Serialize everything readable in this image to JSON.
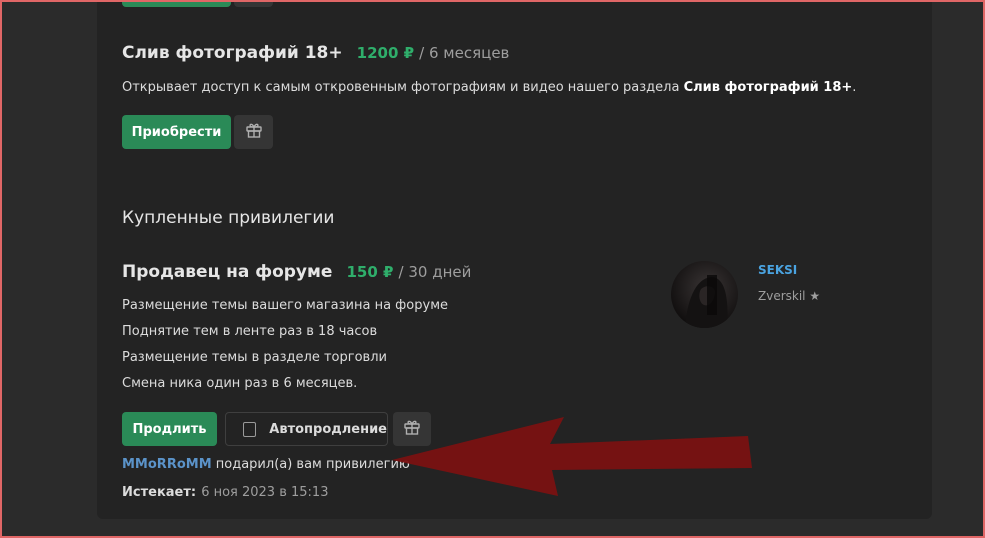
{
  "top_item": {
    "title": "Слив фотографий 18+",
    "price": "1200 ₽",
    "period": "/ 6 месяцев",
    "description_prefix": "Открывает доступ к самым откровенным фотографиям и видео нашего раздела ",
    "description_bold": "Слив фотографий 18+",
    "description_suffix": ".",
    "buy_label": "Приобрести"
  },
  "purchased": {
    "section_title": "Купленные привилегии",
    "item": {
      "title": "Продавец на форуме",
      "price": "150 ₽",
      "period": "/ 30 дней",
      "features": [
        "Размещение темы вашего магазина на форуме",
        "Поднятие тем в ленте раз в 18 часов",
        "Размещение темы в разделе торговли",
        "Смена ника один раз в 6 месяцев."
      ],
      "renew_label": "Продлить",
      "autorenew_label": "Автопродление",
      "gift_from_user": "MMoRRoMM",
      "gift_text": " подарил(а) вам привилегию",
      "expires_label": "Истекает:",
      "expires_value": "6 ноя 2023 в 15:13"
    },
    "seller": {
      "name": "SEKSI",
      "subtitle": "Zverskil ★"
    }
  },
  "icons": {
    "gift": "gift-icon",
    "arrow": "red-arrow-annotation"
  },
  "colors": {
    "accent_green": "#2a8a57",
    "price_green": "#2fae6b",
    "link_blue": "#4aa3e0",
    "annotation_red": "#7a1212",
    "frame_red": "#e06666"
  }
}
